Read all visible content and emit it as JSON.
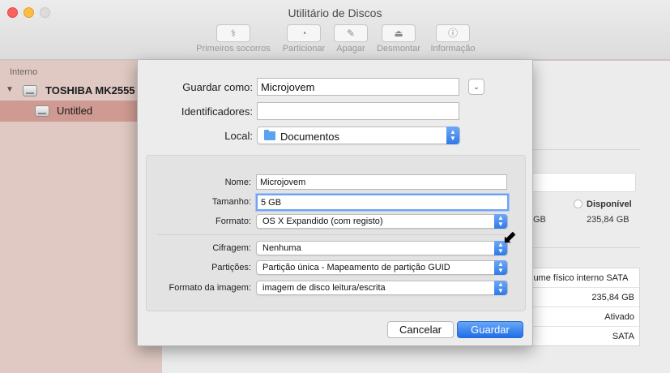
{
  "window": {
    "title": "Utilitário de Discos"
  },
  "toolbar": {
    "items": [
      {
        "label": "Primeiros socorros",
        "icon": "stethoscope-icon",
        "glyph": "⚕"
      },
      {
        "label": "Particionar",
        "icon": "partition-icon",
        "glyph": "◔"
      },
      {
        "label": "Apagar",
        "icon": "erase-icon",
        "glyph": "✎"
      },
      {
        "label": "Desmontar",
        "icon": "unmount-icon",
        "glyph": "⏏"
      },
      {
        "label": "Informação",
        "icon": "info-icon",
        "glyph": "ⓘ"
      }
    ]
  },
  "sidebar": {
    "section": "Interno",
    "disk": "TOSHIBA MK2555",
    "volume": "Untitled"
  },
  "background": {
    "available_label": "Disponível",
    "col1_value": "GB",
    "available_value": "235,84 GB",
    "table": [
      {
        "text": "lume físico interno SATA",
        "align": "left"
      },
      {
        "text": "235,84 GB",
        "align": "right"
      },
      {
        "text": "Ativado",
        "align": "right"
      },
      {
        "text": "SATA",
        "align": "right"
      }
    ]
  },
  "sheet": {
    "save_as_label": "Guardar como:",
    "save_as_value": "Microjovem",
    "tags_label": "Identificadores:",
    "tags_value": "",
    "location_label": "Local:",
    "location_value": "Documentos",
    "name_label": "Nome:",
    "name_value": "Microjovem",
    "size_label": "Tamanho:",
    "size_value": "5 GB",
    "format_label": "Formato:",
    "format_value": "OS X Expandido (com registo)",
    "encryption_label": "Cifragem:",
    "encryption_value": "Nenhuma",
    "partitions_label": "Partições:",
    "partitions_value": "Partição única - Mapeamento de partição GUID",
    "image_format_label": "Formato da imagem:",
    "image_format_value": "imagem de disco leitura/escrita",
    "cancel_label": "Cancelar",
    "save_label": "Guardar"
  },
  "colors": {
    "accent": "#2e7ae8",
    "sidebar_selected": "#cf9a92",
    "sidebar_bg": "#dfc9c2"
  }
}
